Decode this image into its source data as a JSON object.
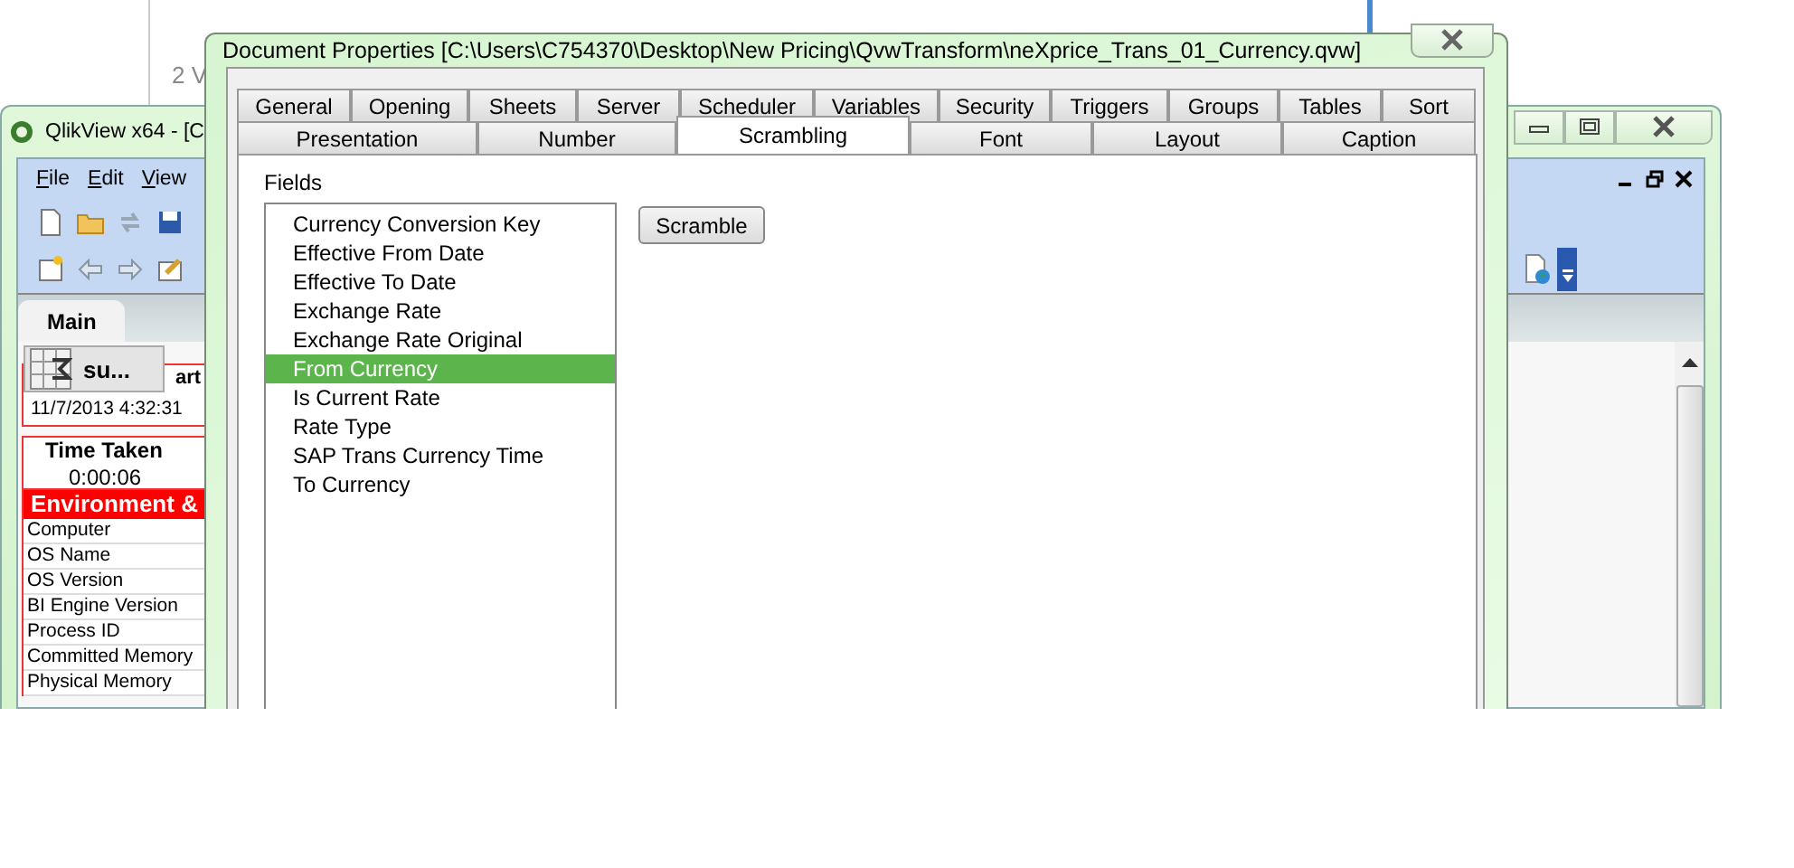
{
  "background_window": {
    "text": "2 V"
  },
  "main_window": {
    "title": "QlikView x64 - [C",
    "menu": [
      {
        "label": "File"
      },
      {
        "label": "Edit"
      },
      {
        "label": "View"
      }
    ],
    "sheet_tabs": [
      {
        "label": "Main",
        "selected": true
      }
    ],
    "minimized_object": {
      "label": "su..."
    },
    "start_box": {
      "header": "art",
      "value": "11/7/2013 4:32:31"
    },
    "time_box": {
      "header": "Time Taken",
      "value": "0:00:06"
    },
    "environment_table": {
      "header": "Environment &",
      "rows": [
        "Computer",
        "OS Name",
        "OS Version",
        "BI Engine Version",
        "Process ID",
        "Committed Memory",
        "Physical Memory"
      ]
    }
  },
  "dialog": {
    "title": "Document Properties [C:\\Users\\C754370\\Desktop\\New Pricing\\QvwTransform\\neXprice_Trans_01_Currency.qvw]",
    "tab_rows": [
      [
        {
          "label": "General",
          "selected": false
        },
        {
          "label": "Opening",
          "selected": false
        },
        {
          "label": "Sheets",
          "selected": false
        },
        {
          "label": "Server",
          "selected": false
        },
        {
          "label": "Scheduler",
          "selected": false
        },
        {
          "label": "Variables",
          "selected": false
        },
        {
          "label": "Security",
          "selected": false
        },
        {
          "label": "Triggers",
          "selected": false
        },
        {
          "label": "Groups",
          "selected": false
        },
        {
          "label": "Tables",
          "selected": false
        },
        {
          "label": "Sort",
          "selected": false
        }
      ],
      [
        {
          "label": "Presentation",
          "selected": false
        },
        {
          "label": "Number",
          "selected": false
        },
        {
          "label": "Scrambling",
          "selected": true
        },
        {
          "label": "Font",
          "selected": false
        },
        {
          "label": "Layout",
          "selected": false
        },
        {
          "label": "Caption",
          "selected": false
        }
      ]
    ],
    "fields_label": "Fields",
    "fields": [
      {
        "name": "Currency Conversion Key",
        "selected": false
      },
      {
        "name": "Effective From Date",
        "selected": false
      },
      {
        "name": "Effective To Date",
        "selected": false
      },
      {
        "name": "Exchange Rate",
        "selected": false
      },
      {
        "name": "Exchange Rate Original",
        "selected": false
      },
      {
        "name": "From Currency",
        "selected": true
      },
      {
        "name": "Is Current Rate",
        "selected": false
      },
      {
        "name": "Rate Type",
        "selected": false
      },
      {
        "name": "SAP Trans Currency Time",
        "selected": false
      },
      {
        "name": "To Currency",
        "selected": false
      }
    ],
    "scramble_button": "Scramble"
  }
}
